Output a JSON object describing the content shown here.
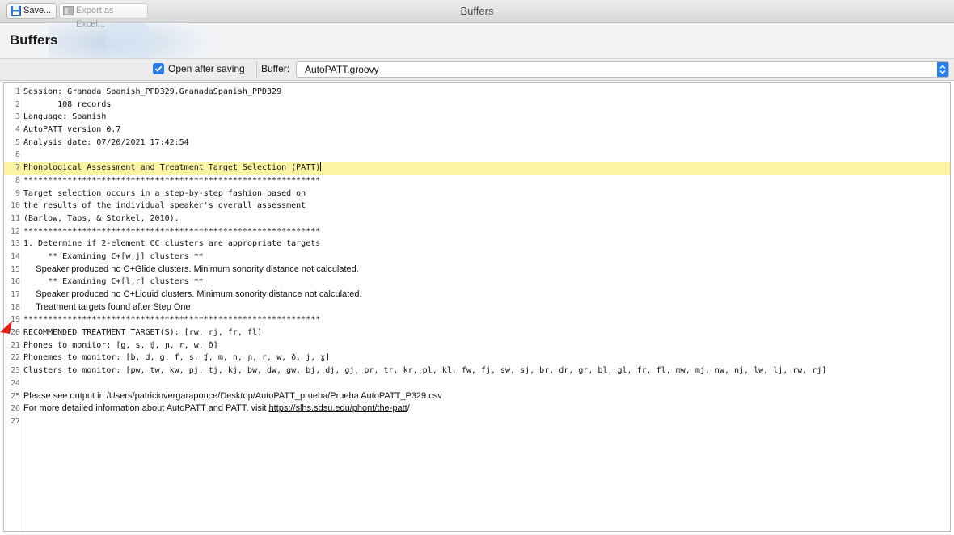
{
  "window": {
    "title": "Buffers"
  },
  "header": {
    "title": "Buffers"
  },
  "toolbar": {
    "save_label": "Save...",
    "export_label": "Export as Excel...",
    "open_after_saving_label": "Open after saving",
    "open_after_saving_checked": true,
    "buffer_label": "Buffer:",
    "buffer_value": "AutoPATT.groovy"
  },
  "editor": {
    "lines": [
      {
        "n": "1",
        "text": "Session: Granada Spanish_PPD329.GranadaSpanish_PPD329"
      },
      {
        "n": "2",
        "text": "       108 records"
      },
      {
        "n": "3",
        "text": "Language: Spanish"
      },
      {
        "n": "4",
        "text": "AutoPATT version 0.7"
      },
      {
        "n": "5",
        "text": "Analysis date: 07/20/2021 17:42:54"
      },
      {
        "n": "6",
        "text": ""
      },
      {
        "n": "7",
        "text": "Phonological Assessment and Treatment Target Selection (PATT)"
      },
      {
        "n": "8",
        "text": "*************************************************************"
      },
      {
        "n": "9",
        "text": "Target selection occurs in a step-by-step fashion based on"
      },
      {
        "n": "10",
        "text": "the results of the individual speaker's overall assessment"
      },
      {
        "n": "11",
        "text": "(Barlow, Taps, & Storkel, 2010)."
      },
      {
        "n": "12",
        "text": "*************************************************************"
      },
      {
        "n": "13",
        "text": "1. Determine if 2-element CC clusters are appropriate targets"
      },
      {
        "n": "14",
        "text": "     ** Examining C+[w,j] clusters **"
      },
      {
        "n": "15",
        "text": "     Speaker produced no C+Glide clusters. Minimum sonority distance not calculated."
      },
      {
        "n": "16",
        "text": "     ** Examining C+[l,r] clusters **"
      },
      {
        "n": "17",
        "text": "     Speaker produced no C+Liquid clusters. Minimum sonority distance not calculated."
      },
      {
        "n": "18",
        "text": "     Treatment targets found after Step One"
      },
      {
        "n": "19",
        "text": "*************************************************************"
      },
      {
        "n": "20",
        "text": "RECOMMENDED TREATMENT TARGET(S): [rw, rj, fr, fl]"
      },
      {
        "n": "21",
        "text": "Phones to monitor: [g, s, ʧ, ɲ, r, w, ð]"
      },
      {
        "n": "22",
        "text": "Phonemes to monitor: [b, d, g, f, s, ʧ, m, n, ɲ, r, w, ð, j, ɣ]"
      },
      {
        "n": "23",
        "text": "Clusters to monitor: [pw, tw, kw, pj, tj, kj, bw, dw, gw, bj, dj, gj, pr, tr, kr, pl, kl, fw, fj, sw, sj, br, dr, gr, bl, gl, fr, fl, mw, mj, nw, nj, lw, lj, rw, rj]"
      },
      {
        "n": "24",
        "text": ""
      },
      {
        "n": "25",
        "text": "Please see output in /Users/patriciovergaraponce/Desktop/AutoPATT_prueba/Prueba AutoPATT_P329.csv"
      },
      {
        "n": "26",
        "text": "For more detailed information about AutoPATT and PATT, visit ",
        "link": "https://slhs.sdsu.edu/phont/the-patt",
        "after": "/"
      },
      {
        "n": "27",
        "text": ""
      }
    ]
  },
  "colors": {
    "highlight": "#fbf5a3",
    "checkbox": "#2a7de1",
    "arrow": "#e0201b"
  },
  "icons": {
    "save": "floppy-disk-icon",
    "export": "excel-icon",
    "annotation": "red-arrow-icon"
  }
}
